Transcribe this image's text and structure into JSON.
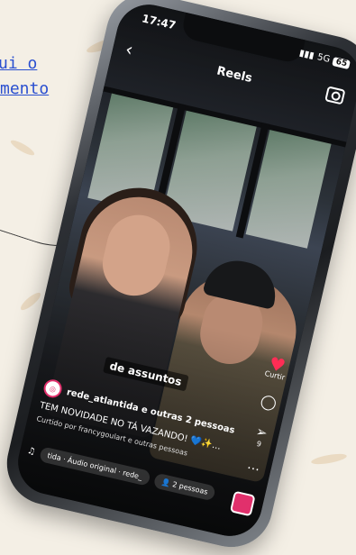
{
  "link": {
    "line1": "ui o",
    "line2": "mento"
  },
  "status_bar": {
    "time": "17:47",
    "network": "5G",
    "battery": "65"
  },
  "header": {
    "title": "Reels"
  },
  "video": {
    "caption_overlay": "de assuntos"
  },
  "post": {
    "account": "rede_atlantida e outras 2 pessoas",
    "caption": "TEM NOVIDADE NO TÁ VAZANDO! 💙✨...",
    "liked_by": "Curtido por francygoulart e outras pessoas"
  },
  "actions": {
    "like_label": "Curtir",
    "share_count": "9"
  },
  "audio": {
    "chip1": "tida · Áudio original · rede_",
    "chip2": "2 pessoas"
  },
  "icons": [
    "back-arrow-icon",
    "camera-icon",
    "heart-icon",
    "comment-icon",
    "send-icon",
    "more-icon",
    "music-note-icon",
    "people-icon"
  ]
}
